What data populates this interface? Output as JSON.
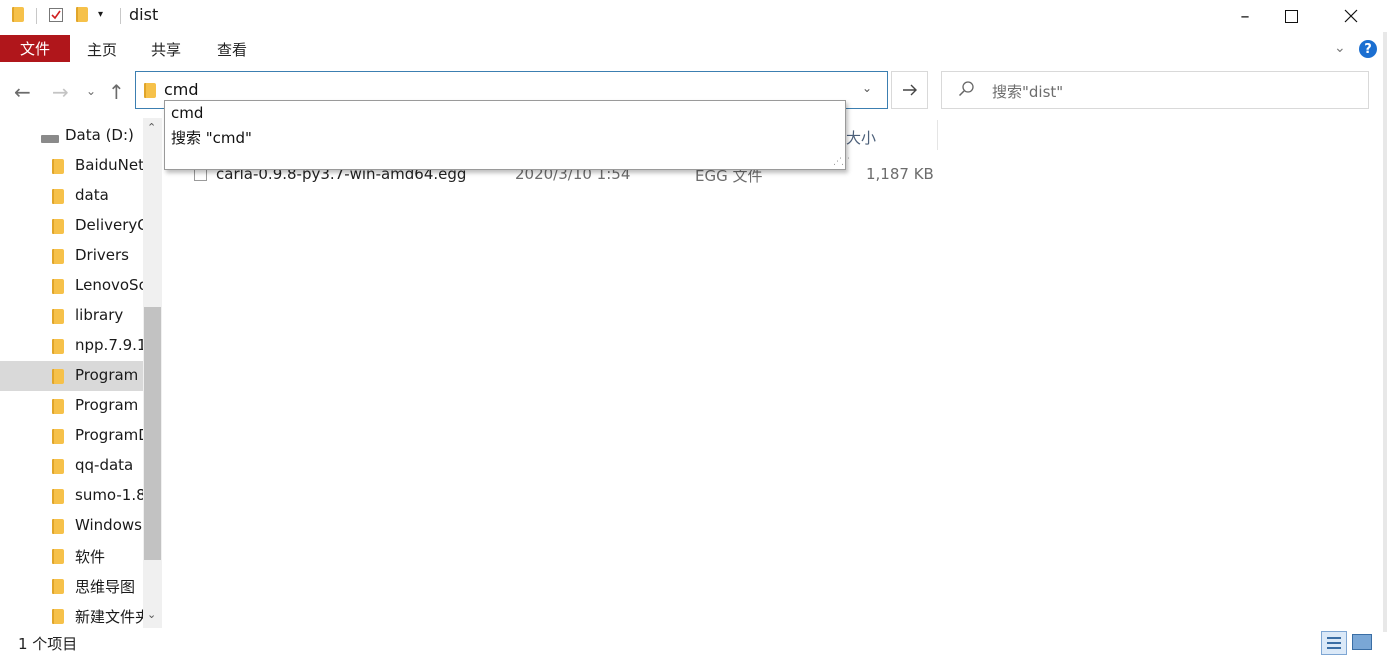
{
  "window": {
    "title": "dist"
  },
  "ribbon": {
    "file_tab": "文件",
    "tabs": [
      "主页",
      "共享",
      "查看"
    ],
    "help": "?"
  },
  "address": {
    "value": "cmd",
    "go_icon": "arrow-right-icon"
  },
  "search": {
    "placeholder": "搜索\"dist\""
  },
  "autocomplete": {
    "items": [
      "cmd",
      "搜索 \"cmd\""
    ]
  },
  "sidebar": {
    "drive": "Data (D:)",
    "items": [
      "BaiduNet",
      "data",
      "DeliveryO",
      "Drivers",
      "LenovoSo",
      "library",
      "npp.7.9.1",
      "Program",
      "Program",
      "ProgramD",
      "qq-data",
      "sumo-1.8",
      "Windows",
      "软件",
      "思维导图",
      "新建文件夹"
    ],
    "selected_index": 7
  },
  "columns": {
    "size": "大小"
  },
  "files": [
    {
      "name": "carla-0.9.8-py3.7-win-amd64.egg",
      "date": "2020/3/10 1:54",
      "type": "EGG 文件",
      "size": "1,187 KB"
    }
  ],
  "status": {
    "count": "1 个项目"
  },
  "colors": {
    "accent": "#b0161b",
    "selection": "#d9d9d9",
    "address_border": "#3c7fb1"
  }
}
